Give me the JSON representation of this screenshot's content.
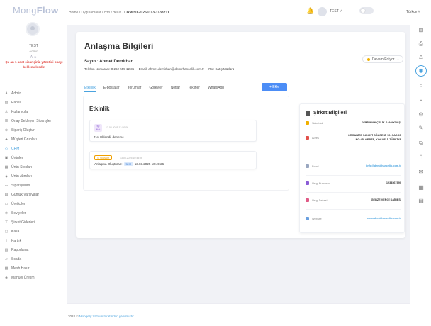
{
  "app": {
    "logo_main": "Mong",
    "logo_accent": "Flow"
  },
  "user": {
    "name": "TEST",
    "role": "Admin",
    "status": "A ☺",
    "pending_notice": "Şu an 1 adet siparişiniz yönetici onayı beklemektedir."
  },
  "sidebar": {
    "items": [
      {
        "label": "Admin",
        "icon": "admin-icon"
      },
      {
        "label": "Panel",
        "icon": "panel-icon"
      },
      {
        "label": "Kullanıcılar",
        "icon": "users-icon"
      },
      {
        "label": "Onay Bekleyen Siparişler",
        "icon": "pending-orders-icon"
      },
      {
        "label": "Sipariş Oluştur",
        "icon": "create-order-icon"
      },
      {
        "label": "Müşteri Grupları",
        "icon": "customer-groups-icon"
      },
      {
        "label": "CRM",
        "icon": "crm-icon",
        "active": true
      },
      {
        "label": "Ürünler",
        "icon": "products-icon"
      },
      {
        "label": "Ürün Stokları",
        "icon": "product-stock-icon"
      },
      {
        "label": "Ürün Alımları",
        "icon": "product-purchase-icon"
      },
      {
        "label": "Siparişlerim",
        "icon": "my-orders-icon"
      },
      {
        "label": "Günlük Varsiyalar",
        "icon": "daily-icon"
      },
      {
        "label": "Üreticiler",
        "icon": "producers-icon"
      },
      {
        "label": "Seviyeler",
        "icon": "levels-icon"
      },
      {
        "label": "Şirket Giderleri",
        "icon": "company-expenses-icon"
      },
      {
        "label": "Kasa",
        "icon": "cash-icon"
      },
      {
        "label": "Kartlık",
        "icon": "card-icon"
      },
      {
        "label": "Raporlama",
        "icon": "reporting-icon"
      },
      {
        "label": "Scada",
        "icon": "scada-icon"
      },
      {
        "label": "Mesh Hasır",
        "icon": "mesh-icon"
      },
      {
        "label": "Manuel Üretim",
        "icon": "manual-production-icon"
      }
    ]
  },
  "breadcrumb": {
    "path": "Home / Uygulamalar / crm / deals / ",
    "current": "CRM-50-20250313-3133211"
  },
  "header": {
    "user_label": "TEST ˅",
    "language": "Türkçe ˅"
  },
  "page": {
    "title": "Anlaşma Bilgileri",
    "contact_name": "Sayın : Ahmet Demirhan",
    "phone": "Telefon Numarası: 0 262 555 12 35",
    "email": "Email: ahmet.demirhan@demirhancelik.com.tr",
    "role": "Rol: Satış Müdürü",
    "status": "Devam Ediyor",
    "add_button": "+ Ekle"
  },
  "tabs": [
    "Etkinlik",
    "E-postalar",
    "Yorumlar",
    "Görevler",
    "Notlar",
    "Teklifler",
    "WhatsApp"
  ],
  "activity": {
    "title": "Etkinlik",
    "items": [
      {
        "badge_top": "👁",
        "badge_bottom": "Not",
        "time": "13.03.2025 13:50:06",
        "text": "Not Eklendi: deneme"
      },
      {
        "badge": "⊙ Oluşum",
        "time": "13.03.2025 10:45:26",
        "text_prefix": "Anlaşma Oluşturan:",
        "tag": "test",
        "text_suffix": "13.03.2025 10:45:26"
      }
    ]
  },
  "company": {
    "title": "Şirket Bilgileri",
    "rows": [
      {
        "label": "Şirket Adı",
        "value": "DEMİRHAN ÇELİK SANAYİ A.Ş.",
        "color": "#f0b000"
      },
      {
        "label": "Adres",
        "value": "ORGANİZE SANAYİ BÖLGESİ, 10. CADDE NO:45, GEBZE, KOCAELİ, TÜRKİYE",
        "color": "#e2514b"
      },
      {
        "label": "Email",
        "value": "info@demirhancelik.com.tr",
        "color": "#9aa7c0",
        "link": true
      },
      {
        "label": "Vergi Numarası",
        "value": "1234567890",
        "color": "#8b5cd6"
      },
      {
        "label": "Vergi Dairesi",
        "value": "GEBZE VERGİ DAİRESİ",
        "color": "#e05a86"
      },
      {
        "label": "Website",
        "value": "www.demirhancelik.com.tr",
        "color": "#6aa0e0",
        "link": true
      }
    ]
  },
  "footer": {
    "year": "2024 ©",
    "brand": "Mongery Yazılım tarafından yapılmıştır."
  },
  "colors": {
    "accent": "#4aa3df",
    "primary_button": "#4c8df6",
    "warning": "#e0413a"
  }
}
